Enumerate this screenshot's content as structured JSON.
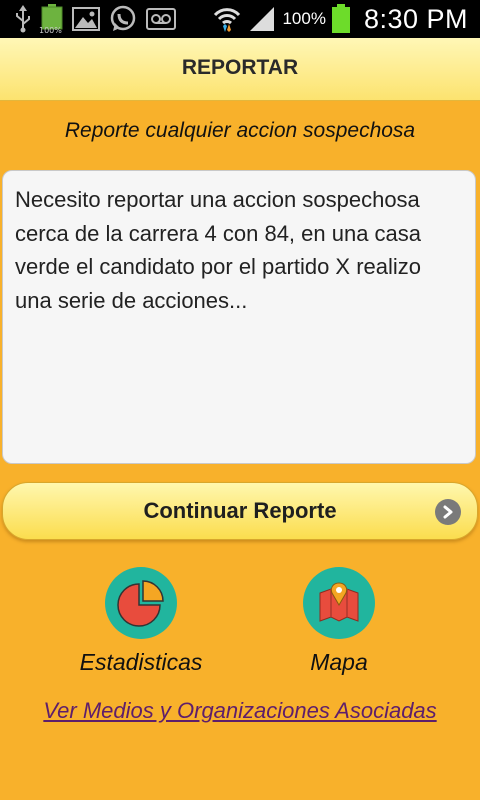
{
  "status_bar": {
    "battery_small_label": "100%",
    "battery_percent": "100%",
    "time": "8:30 PM",
    "icons": [
      "usb-icon",
      "battery-full-icon",
      "gallery-icon",
      "whatsapp-icon",
      "voicemail-icon",
      "wifi-icon",
      "signal-icon",
      "battery-icon"
    ]
  },
  "header": {
    "title": "REPORTAR"
  },
  "subtitle": "Reporte cualquier accion sospechosa",
  "report": {
    "text": "Necesito reportar una accion sospechosa cerca de la carrera 4 con 84, en una casa verde el candidato por el partido X realizo una serie de acciones..."
  },
  "continue_button": {
    "label": "Continuar Reporte",
    "icon": "chevron-right-icon"
  },
  "actions": [
    {
      "label": "Estadisticas",
      "icon": "pie-chart-icon"
    },
    {
      "label": "Mapa",
      "icon": "map-icon"
    }
  ],
  "link": {
    "label": "Ver Medios y Organizaciones Asociadas"
  },
  "colors": {
    "background": "#F8B12B",
    "header": "#FCE36F",
    "icon_circle": "#21B59E",
    "link": "#5E1E6B"
  }
}
